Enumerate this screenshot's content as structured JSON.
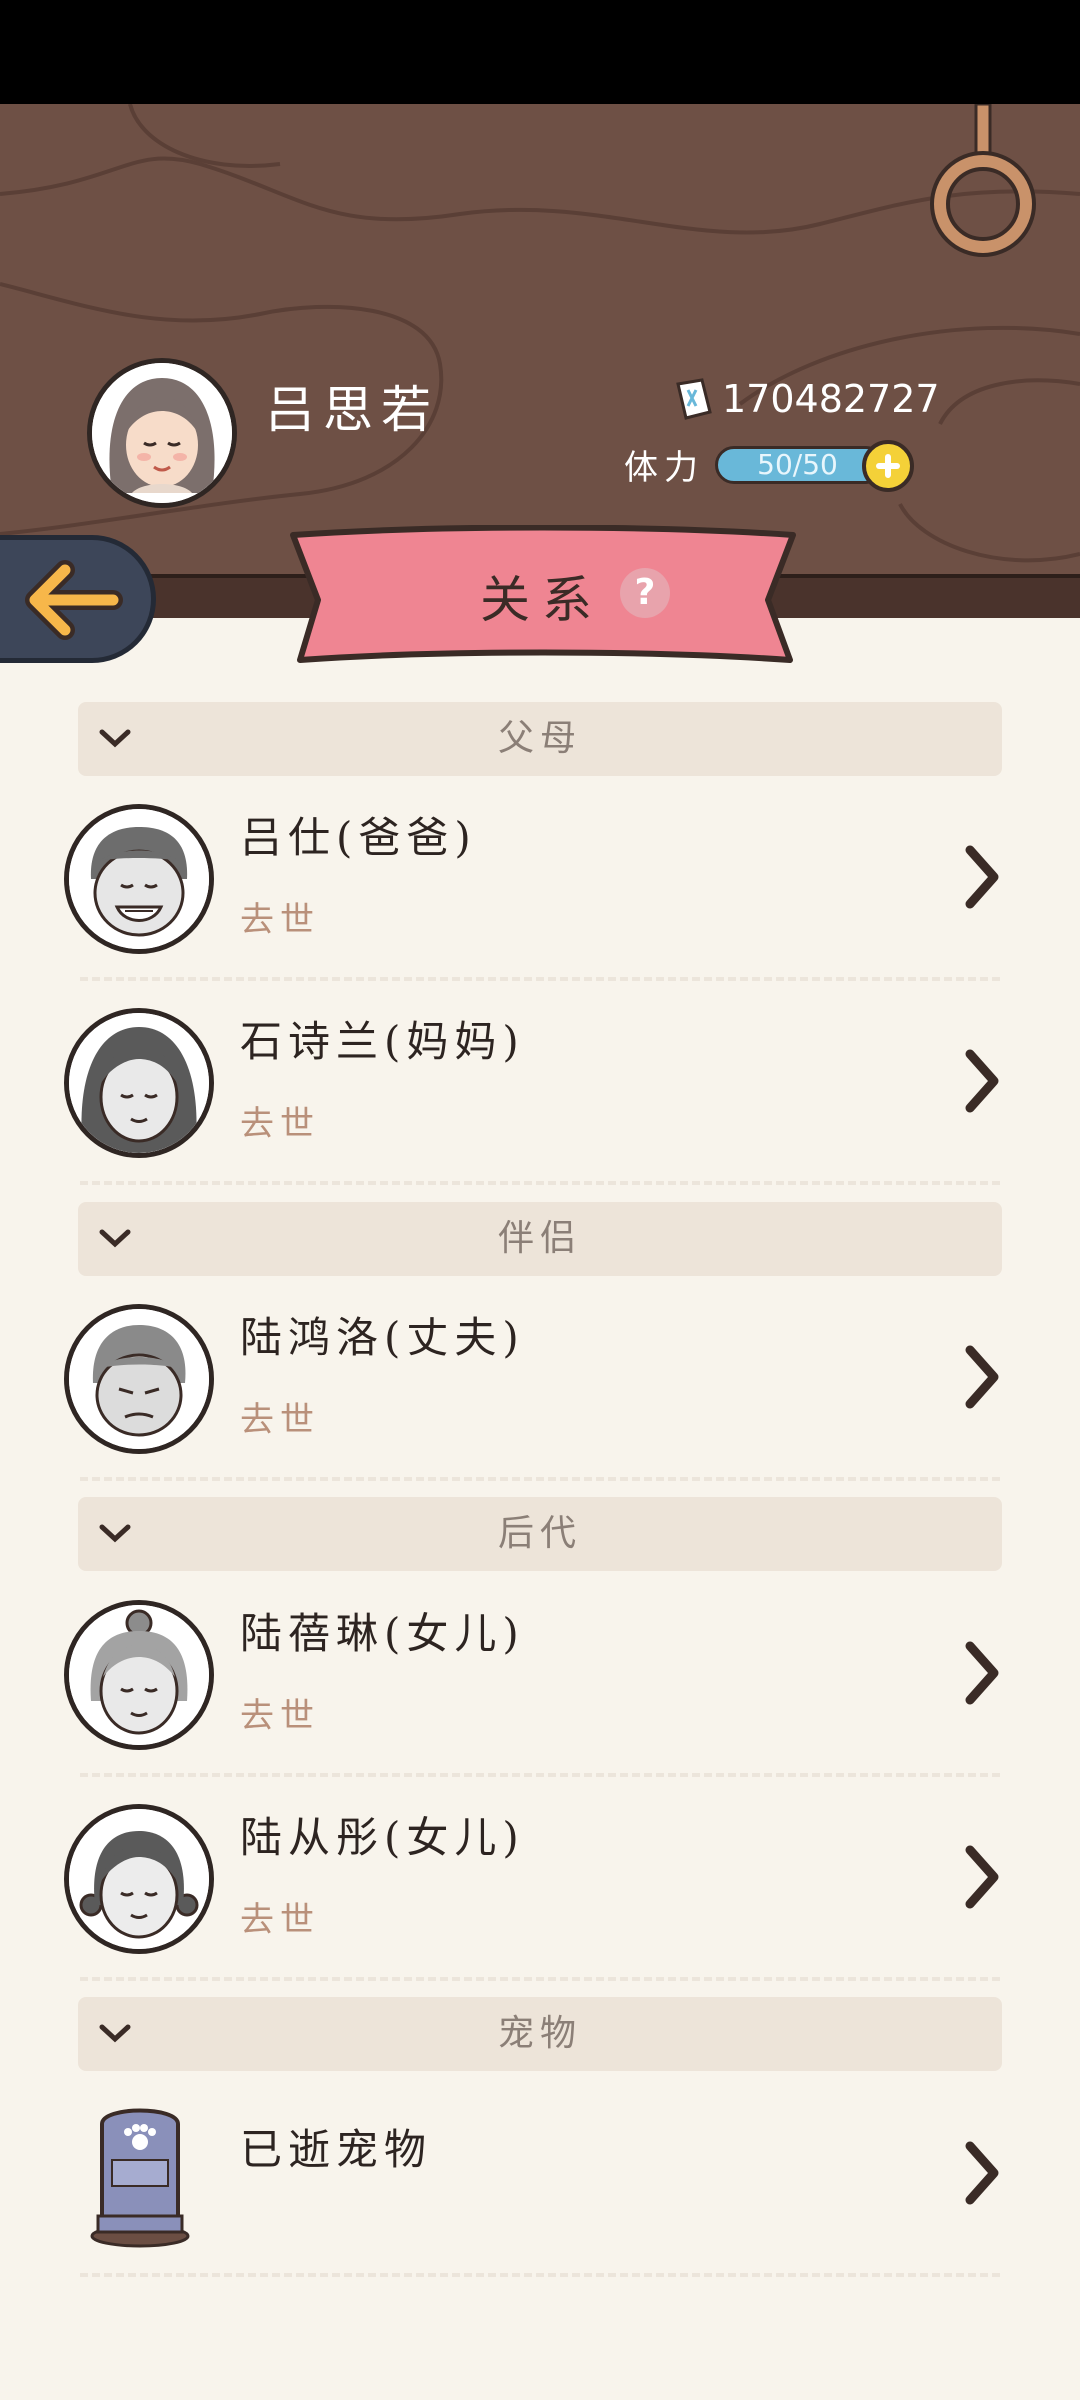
{
  "player": {
    "name": "吕思若",
    "coins": "170482727",
    "stamina_label": "体力",
    "stamina_value": "50/50"
  },
  "page": {
    "title": "关系",
    "help": "?"
  },
  "sections": [
    {
      "title": "父母",
      "members": [
        {
          "name": "吕仕(爸爸)",
          "status": "去世"
        },
        {
          "name": "石诗兰(妈妈)",
          "status": "去世"
        }
      ]
    },
    {
      "title": "伴侣",
      "members": [
        {
          "name": "陆鸿洛(丈夫)",
          "status": "去世"
        }
      ]
    },
    {
      "title": "后代",
      "members": [
        {
          "name": "陆蓓琳(女儿)",
          "status": "去世"
        },
        {
          "name": "陆从彤(女儿)",
          "status": "去世"
        }
      ]
    },
    {
      "title": "宠物",
      "members": [
        {
          "name": "已逝宠物",
          "status": ""
        }
      ]
    }
  ],
  "colors": {
    "wood": "#6e5045",
    "banner": "#ef8592",
    "accent_yellow": "#f4d138",
    "status_text": "#b9907a"
  }
}
